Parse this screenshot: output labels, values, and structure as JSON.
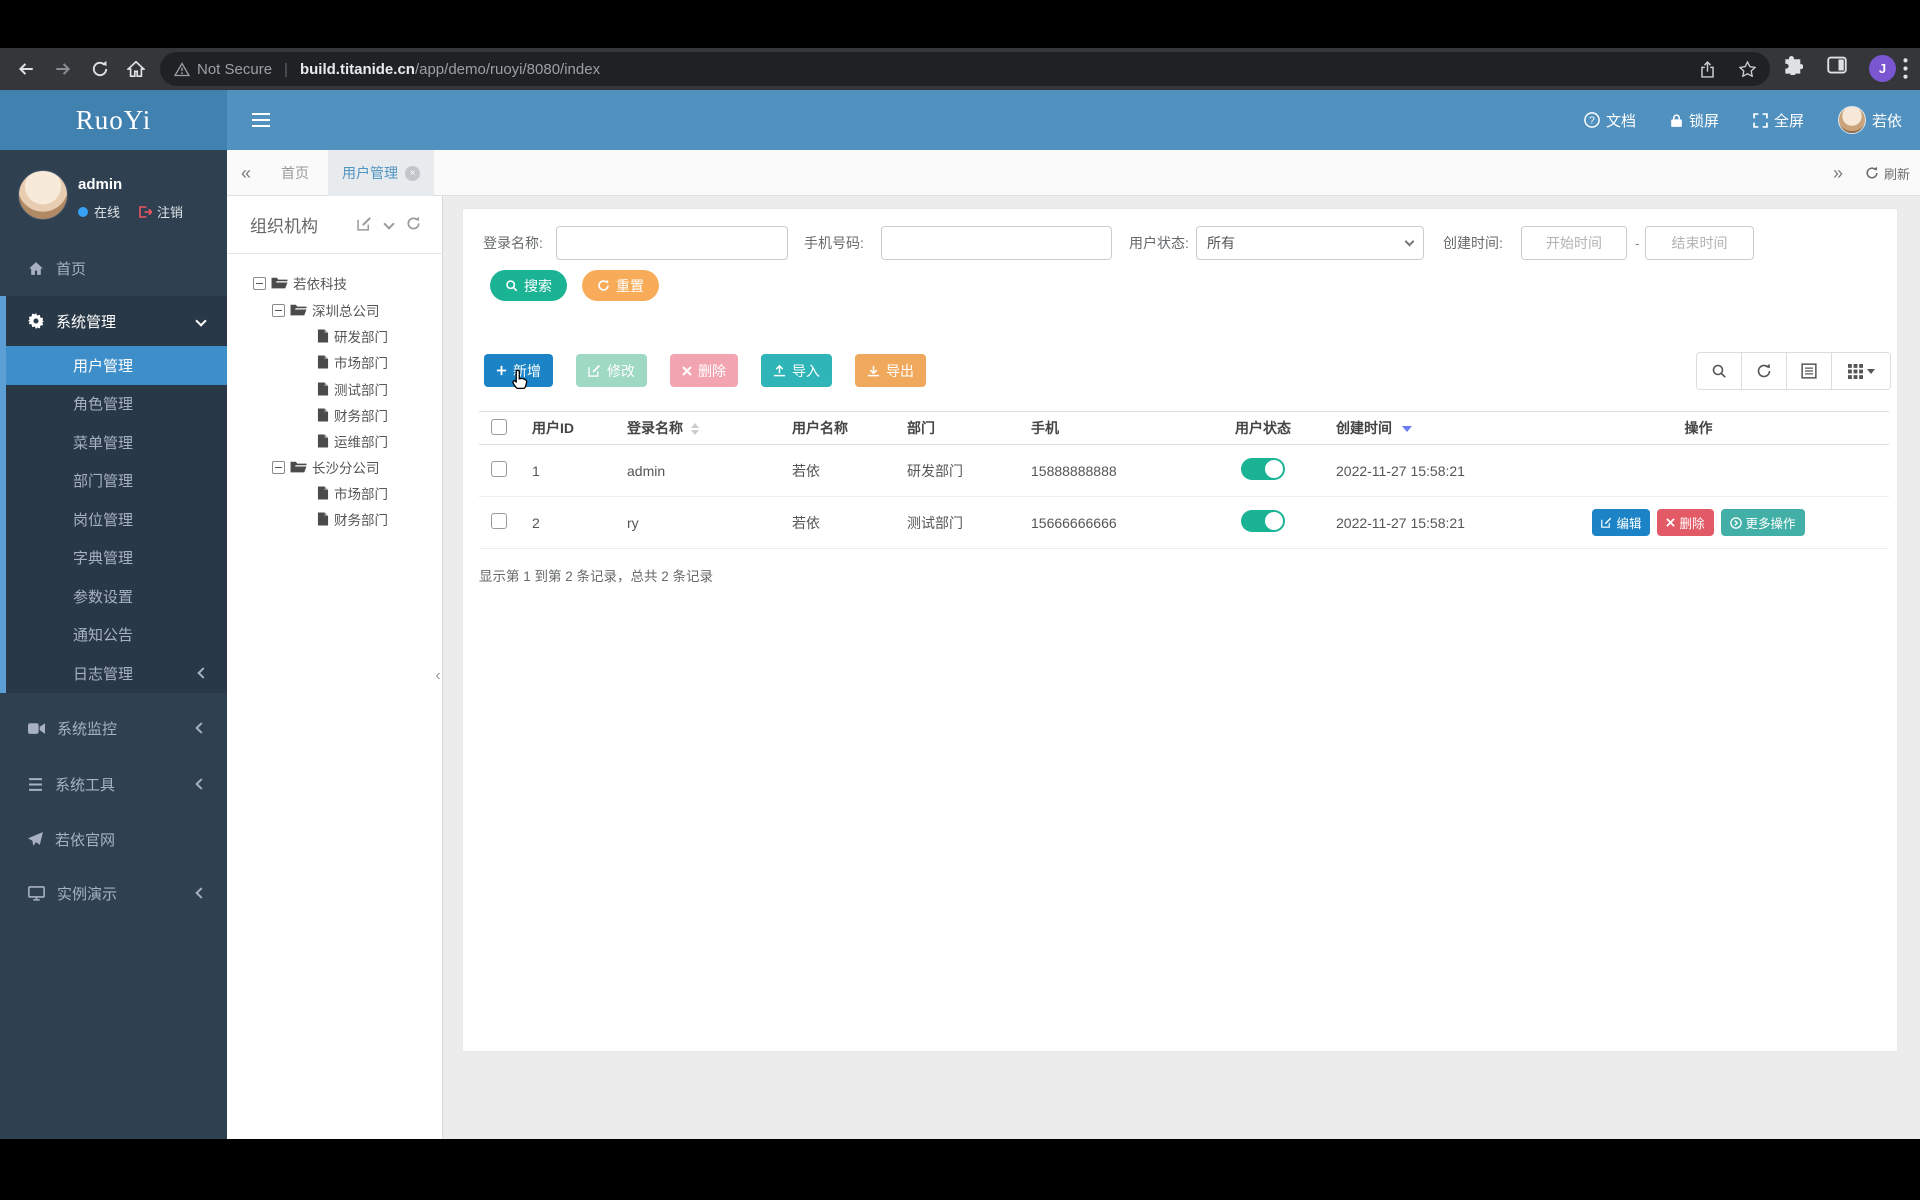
{
  "browser": {
    "security": "Not Secure",
    "url_domain": "build.titanide.cn",
    "url_path": "/app/demo/ruoyi/8080/index",
    "profile_initial": "J"
  },
  "header": {
    "logo": "RuoYi",
    "docs": "文档",
    "lock_screen": "锁屏",
    "fullscreen": "全屏",
    "user_name": "若依"
  },
  "sidebar": {
    "user_name": "admin",
    "status_online": "在线",
    "logout": "注销",
    "home": "首页",
    "system_management": "系统管理",
    "submenu": [
      "用户管理",
      "角色管理",
      "菜单管理",
      "部门管理",
      "岗位管理",
      "字典管理",
      "参数设置",
      "通知公告",
      "日志管理"
    ],
    "system_monitor": "系统监控",
    "system_tools": "系统工具",
    "official_site": "若依官网",
    "demo": "实例演示"
  },
  "tabbar": {
    "home_tab": "首页",
    "active_tab": "用户管理",
    "refresh": "刷新"
  },
  "tree": {
    "title": "组织机构",
    "nodes": [
      {
        "label": "若依科技"
      },
      {
        "label": "深圳总公司"
      },
      {
        "label": "研发部门"
      },
      {
        "label": "市场部门"
      },
      {
        "label": "测试部门"
      },
      {
        "label": "财务部门"
      },
      {
        "label": "运维部门"
      },
      {
        "label": "长沙分公司"
      },
      {
        "label": "市场部门"
      },
      {
        "label": "财务部门"
      }
    ]
  },
  "filters": {
    "login_name_label": "登录名称:",
    "phone_label": "手机号码:",
    "status_label": "用户状态:",
    "status_value": "所有",
    "created_label": "创建时间:",
    "start_placeholder": "开始时间",
    "range_separator": "-",
    "end_placeholder": "结束时间",
    "search": "搜索",
    "reset": "重置"
  },
  "toolbar": {
    "add": "新增",
    "modify": "修改",
    "remove": "删除",
    "import": "导入",
    "export": "导出"
  },
  "table": {
    "headers": [
      "用户ID",
      "登录名称",
      "用户名称",
      "部门",
      "手机",
      "用户状态",
      "创建时间",
      "操作"
    ],
    "rows": [
      {
        "user_id": "1",
        "login_name": "admin",
        "user_name": "若依",
        "dept": "研发部门",
        "phone": "15888888888",
        "created": "2022-11-27 15:58:21"
      },
      {
        "user_id": "2",
        "login_name": "ry",
        "user_name": "若依",
        "dept": "测试部门",
        "phone": "15666666666",
        "created": "2022-11-27 15:58:21"
      }
    ],
    "actions": {
      "edit": "编辑",
      "remove": "删除",
      "more": "更多操作"
    },
    "summary": "显示第 1 到第 2 条记录，总共 2 条记录"
  },
  "colors": {
    "header_blue": "#5191bf",
    "logo_blue": "#4181b0",
    "sidebar_dark": "#2f4050",
    "submenu_dark": "#283846",
    "active_item_blue": "#3d8ec9",
    "accent_strip": "#5b9fd4",
    "success_green": "#1ab394",
    "warning_orange": "#f8ac59",
    "primary_blue": "#1c84c6",
    "info_teal": "#23c6c8",
    "danger_red": "#ed5565",
    "toggle_on": "#1ab394",
    "online_dot": "#38a1f3"
  }
}
